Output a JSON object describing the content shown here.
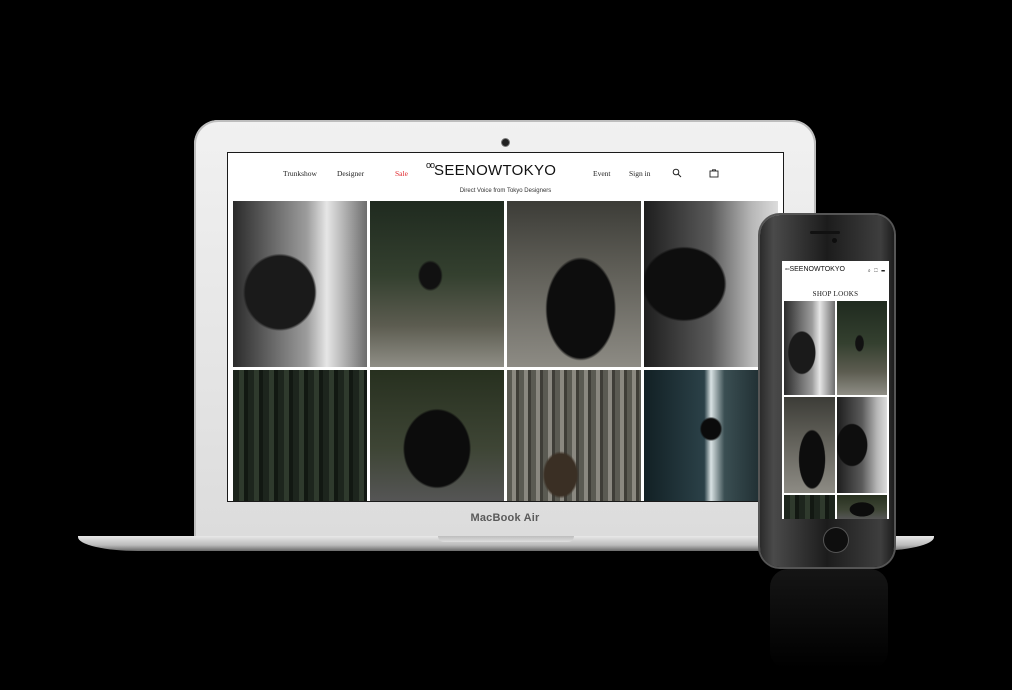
{
  "laptop": {
    "brand_label": "MacBook Air",
    "site": {
      "nav": {
        "trunkshow": "Trunkshow",
        "designer": "Designer",
        "sale": "Sale",
        "event": "Event",
        "signin": "Sign in"
      },
      "logo_mark": "oo",
      "logo_text": "SEENOWTOKYO",
      "tagline": "Direct Voice from Tokyo Designers",
      "icons": {
        "search": "search-icon",
        "cart": "bag-icon"
      },
      "colors": {
        "sale": "#e0262c",
        "text": "#222222",
        "background": "#ffffff"
      }
    }
  },
  "phone": {
    "logo_mark": "oo",
    "logo_text": "SEENOWTOKYO",
    "icons_text": "⌕ ⬚ ☰",
    "page_title": "SHOP LOOKS"
  }
}
